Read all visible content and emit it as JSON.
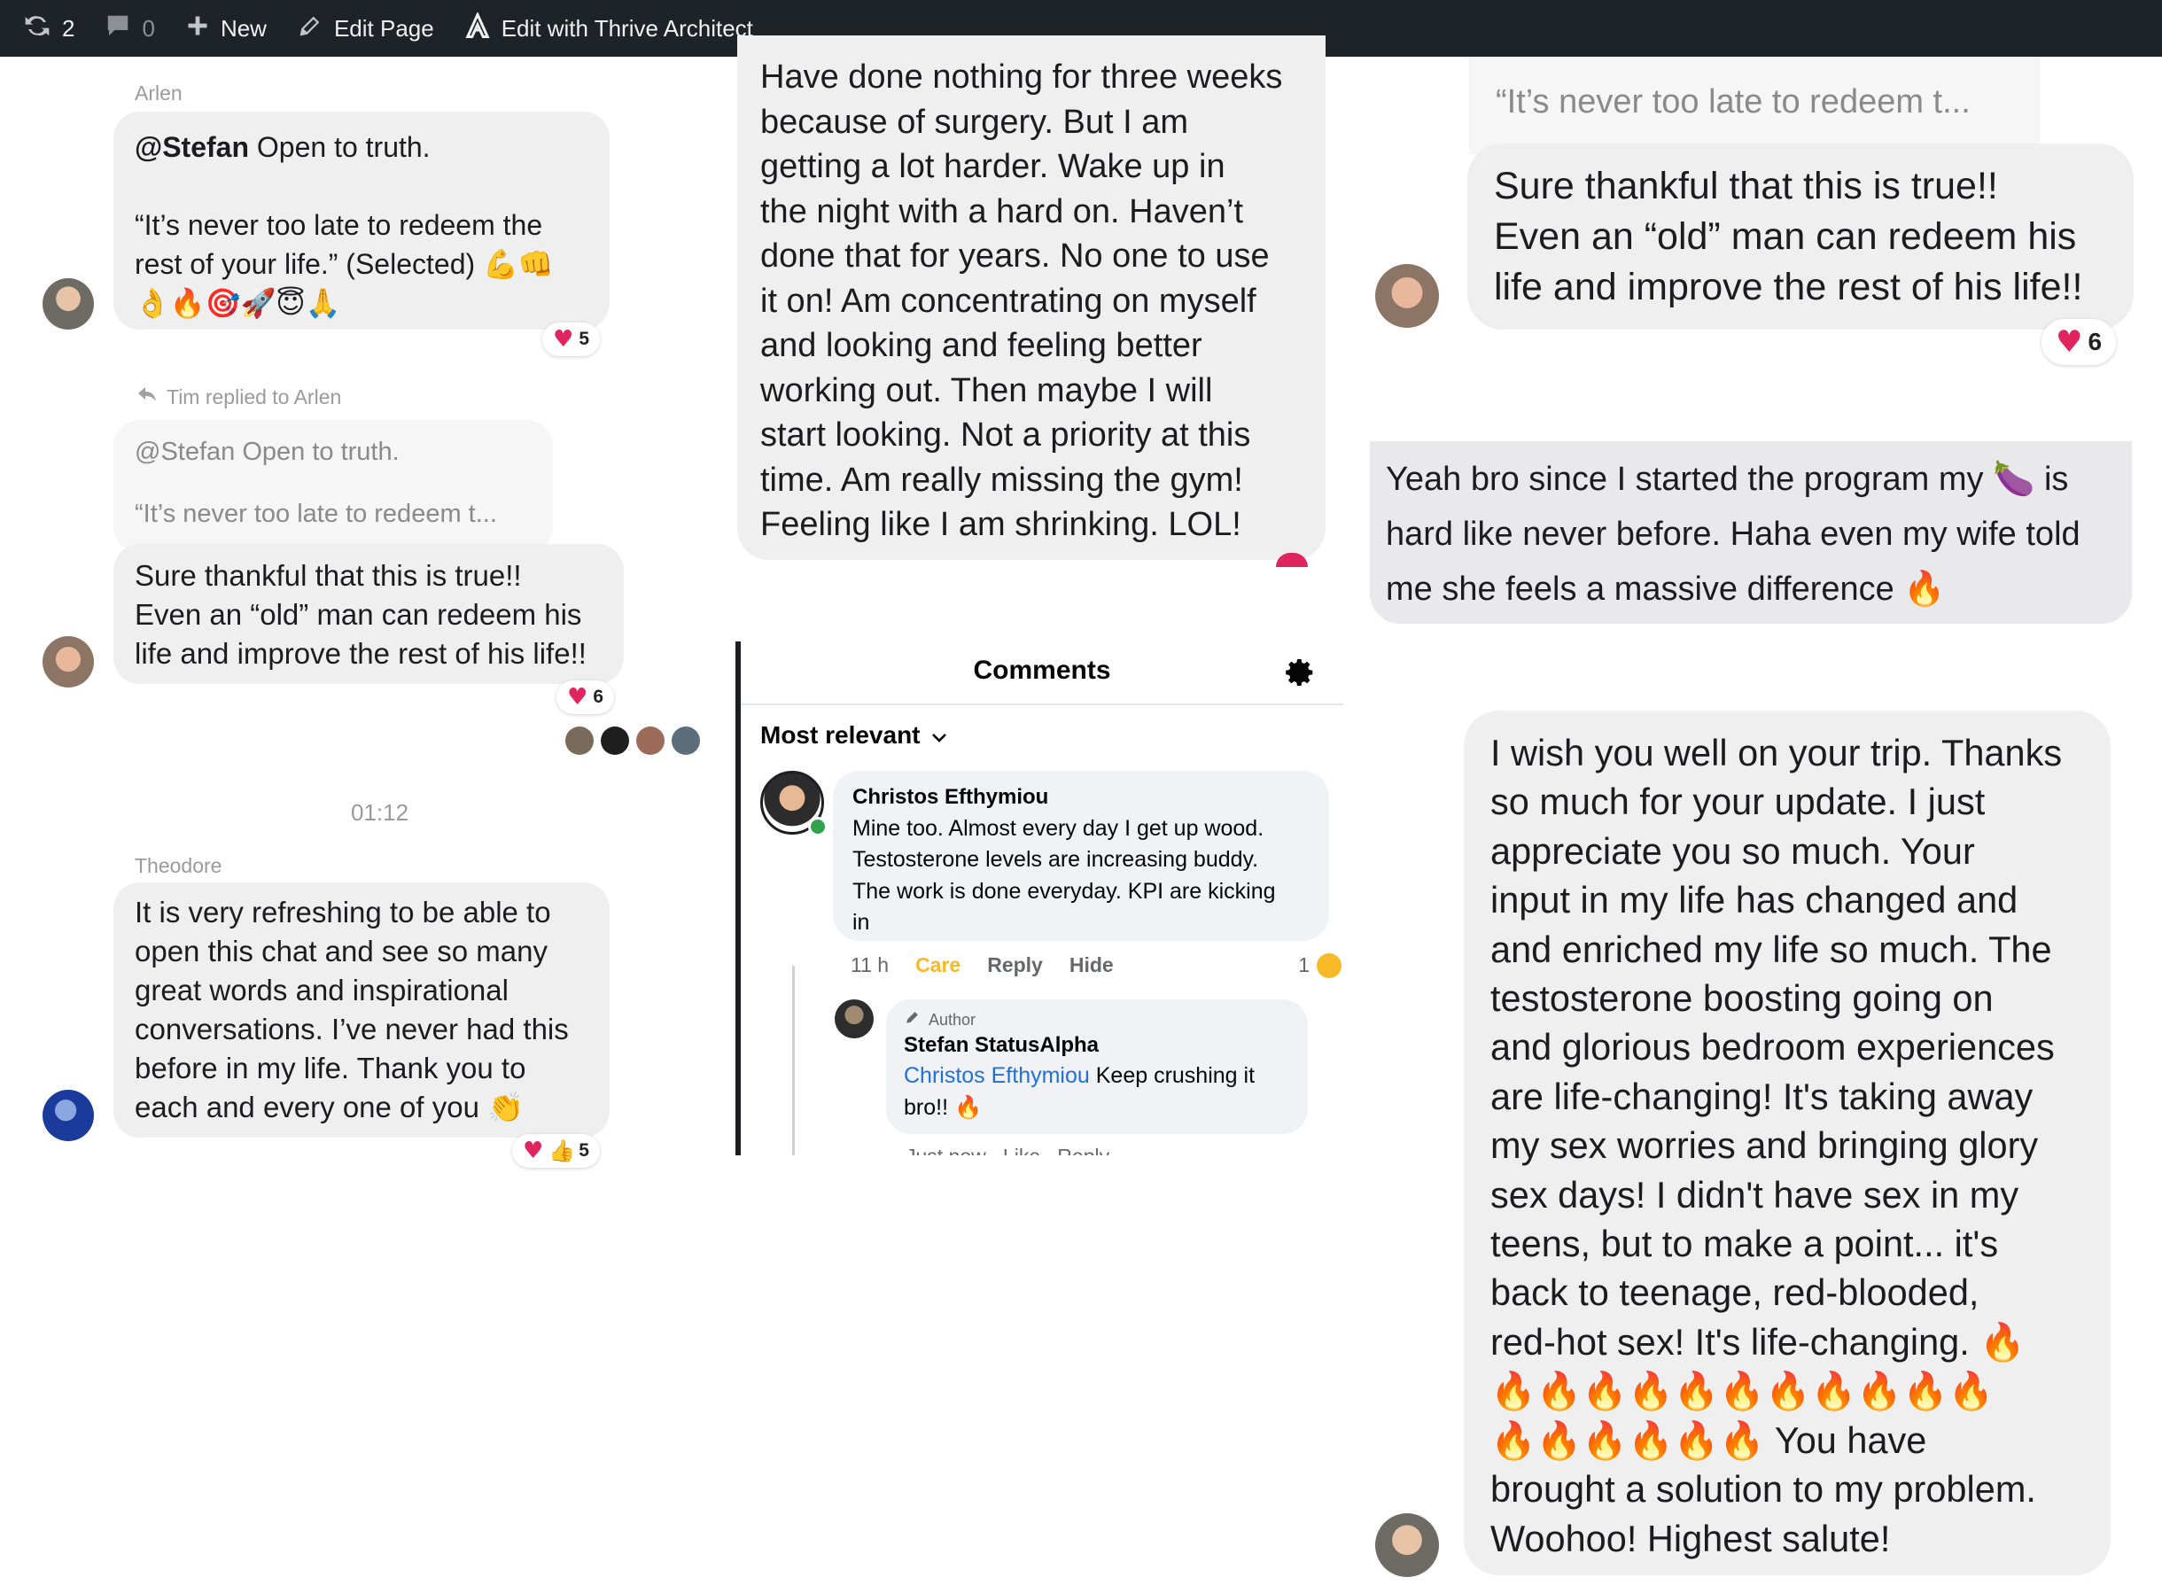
{
  "adminbar": {
    "updates_count": "2",
    "comments_count": "0",
    "new_label": "New",
    "edit_page_label": "Edit Page",
    "thrive_label": "Edit with Thrive Architect"
  },
  "col1": {
    "arlen": {
      "sender": "Arlen",
      "mention": "@Stefan",
      "line1_rest": " Open to truth.",
      "quote_line1": "“It’s never too late to redeem the",
      "quote_line2": "rest of your life.” (Selected) 💪👊",
      "emoji_line": "👌🔥🎯🚀😇🙏",
      "reaction_count": "5"
    },
    "tim": {
      "replied_label": "Tim replied to Arlen",
      "quoted_line1": "@Stefan Open to truth.",
      "quoted_line2": "“It’s never too late to redeem t...",
      "line1": "Sure thankful that this is true!!",
      "line2": "Even an “old” man can redeem his",
      "line3": "life and improve the rest of his life!!",
      "reaction_count": "6"
    },
    "timestamp": "01:12",
    "theodore": {
      "sender": "Theodore",
      "line1": "It is very refreshing to be able to",
      "line2": "open this chat and see so many",
      "line3": "great words and inspirational",
      "line4": "conversations. I’ve never had this",
      "line5": "before in my life. Thank you to",
      "line6": "each and every one of you 👏",
      "reaction_count": "5"
    }
  },
  "col2": {
    "message": {
      "line1": "Have done nothing for three weeks",
      "line2": "because of surgery.  But I am",
      "line3": "getting a lot harder.  Wake up in",
      "line4": "the night with a hard on.  Haven’t",
      "line5": "done that for years.  No one to use",
      "line6": "it on!  Am concentrating on myself",
      "line7": "and looking and feeling better",
      "line8": "working out.  Then maybe I will",
      "line9": "start looking.  Not a priority at this",
      "line10": "time.  Am really missing the gym!",
      "line11": "Feeling like I am shrinking. LOL!"
    },
    "fb": {
      "title": "Comments",
      "sort_label": "Most relevant",
      "comment": {
        "author": "Christos Efthymiou",
        "line1": "Mine too. Almost every day I get up wood.",
        "line2": "Testosterone levels are increasing buddy.",
        "line3": "The work is done everyday. KPI are kicking",
        "line4": "in",
        "time": "11 h",
        "care_label": "Care",
        "reply_label": "Reply",
        "hide_label": "Hide",
        "reaction_count": "1"
      },
      "reply": {
        "badge": "Author",
        "author": "Stefan StatusAlpha",
        "mention": "Christos Efthymiou",
        "text_rest": " Keep crushing it",
        "line2": "bro!! 🔥",
        "meta_partial": "Just now   Like   Reply"
      }
    }
  },
  "col3": {
    "tim_repeat": {
      "quoted": "“It’s never too late to redeem t...",
      "line1": "Sure thankful that this is true!!",
      "line2": "Even an “old” man can redeem his",
      "line3": "life and improve the rest of his life!!",
      "reaction_count": "6"
    },
    "yeah": {
      "line1_a": "Yeah bro since I started the program my ",
      "eggplant": "🍆",
      "line1_b": " is",
      "line2": "hard like never before. Haha even my wife told",
      "line3": "me she feels a massive difference 🔥"
    },
    "wish": {
      "line1": "I wish you well on your trip. Thanks",
      "line2": "so much for your update. I just",
      "line3": "appreciate you so much. Your",
      "line4": "input in my life has changed and",
      "line5": "and enriched my life so much. The",
      "line6": "testosterone boosting going on",
      "line7": "and glorious bedroom experiences",
      "line8": "are life-changing! It's taking away",
      "line9": "my sex worries and bringing glory",
      "line10": "sex days! I didn't have sex in my",
      "line11": "teens, but to make a point... it's",
      "line12": "back to teenage, red-blooded,",
      "line13": "red-hot sex! It's life-changing. 🔥",
      "line14": "🔥🔥🔥🔥🔥🔥🔥🔥🔥🔥🔥",
      "line15_fires": "🔥🔥🔥🔥🔥🔥",
      "line15_text": " You have",
      "line16": "brought a solution to my problem.",
      "line17": "Woohoo! Highest salute!"
    }
  },
  "colors": {
    "admin_bar": "#1d2327",
    "bubble": "#efefef",
    "heart": "#e0245e",
    "facebook_link": "#216fdb",
    "care": "#f7b928"
  }
}
